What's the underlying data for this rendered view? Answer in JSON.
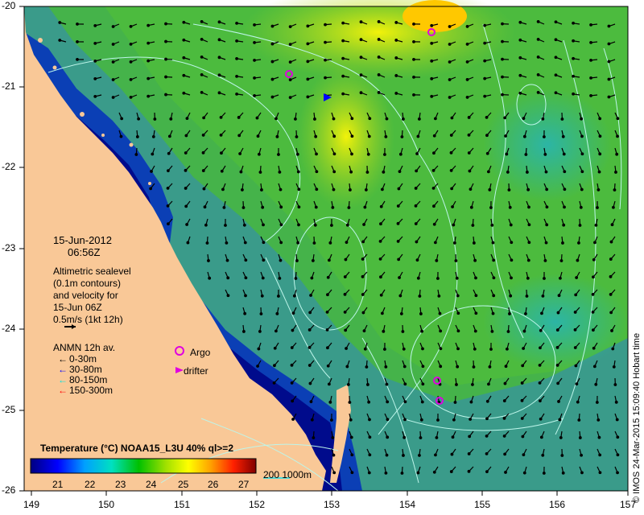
{
  "map": {
    "x_axis_labels": [
      "149",
      "150",
      "151",
      "152",
      "153",
      "154",
      "155",
      "156",
      "157"
    ],
    "y_axis_labels": [
      "-20",
      "-21",
      "-22",
      "-23",
      "-24",
      "-25",
      "-26"
    ],
    "date": "15-Jun-2012",
    "time": "06:56Z",
    "altimetry_lines": [
      "Altimetric sealevel",
      "(0.1m contours)",
      "and velocity for",
      "15-Jun 06Z",
      "0.5m/s (1kt 12h)"
    ],
    "anmn_title": "ANMN 12h av.",
    "anmn_items": [
      {
        "label": "0-30m",
        "color": "#000000"
      },
      {
        "label": "30-80m",
        "color": "#0000ff"
      },
      {
        "label": "80-150m",
        "color": "#00e5e5"
      },
      {
        "label": "150-300m",
        "color": "#ff0000"
      }
    ],
    "argo_label": "Argo",
    "drifter_label": "drifter",
    "temperature_title": "Temperature (°C) NOAA15_L3U 40% ql>=2",
    "colorbar_ticks": [
      "21",
      "22",
      "23",
      "24",
      "25",
      "26",
      "27"
    ],
    "contour_legend": "200  1000m",
    "credit": "© IMOS 24-Mar-2015 15:09:40 Hobart time",
    "colors": {
      "land": "#f9c897",
      "deep_ocean": "#000b8c",
      "mid_ocean": "#2c9a8e",
      "warm": "#b5e61d",
      "contour": "#bdf5ea",
      "argo": "#e000e0"
    }
  }
}
